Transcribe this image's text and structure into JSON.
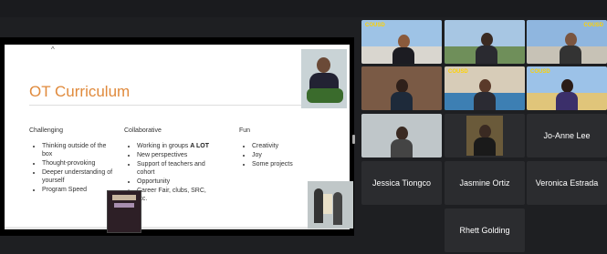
{
  "slide": {
    "title": "OT Curriculum",
    "columns": [
      {
        "heading": "Challenging",
        "items": [
          "Thinking outside of the box",
          "Thought-provoking",
          "Deeper understanding of yourself",
          "Program Speed"
        ]
      },
      {
        "heading": "Collaborative",
        "items": [
          {
            "text": "Working in groups ",
            "bold": "A LOT"
          },
          {
            "text": "New perspectives"
          },
          {
            "text": "Support of teachers and cohort"
          },
          {
            "text": "Opportunity"
          }
        ],
        "subitems": [
          "Career Fair, clubs, SRC, etc."
        ]
      },
      {
        "heading": "Fun",
        "items": [
          "Creativity",
          "Joy",
          "Some projects"
        ]
      }
    ]
  },
  "participants": {
    "brand_label": "COUSD",
    "named": [
      "Jo-Anne Lee",
      "Jessica Tiongco",
      "Jasmine Ortiz",
      "Veronica Estrada",
      "Rhett Golding"
    ]
  },
  "colors": {
    "title": "#e08a3c",
    "active_speaker": "#54b848",
    "brand": "#ffd200"
  }
}
